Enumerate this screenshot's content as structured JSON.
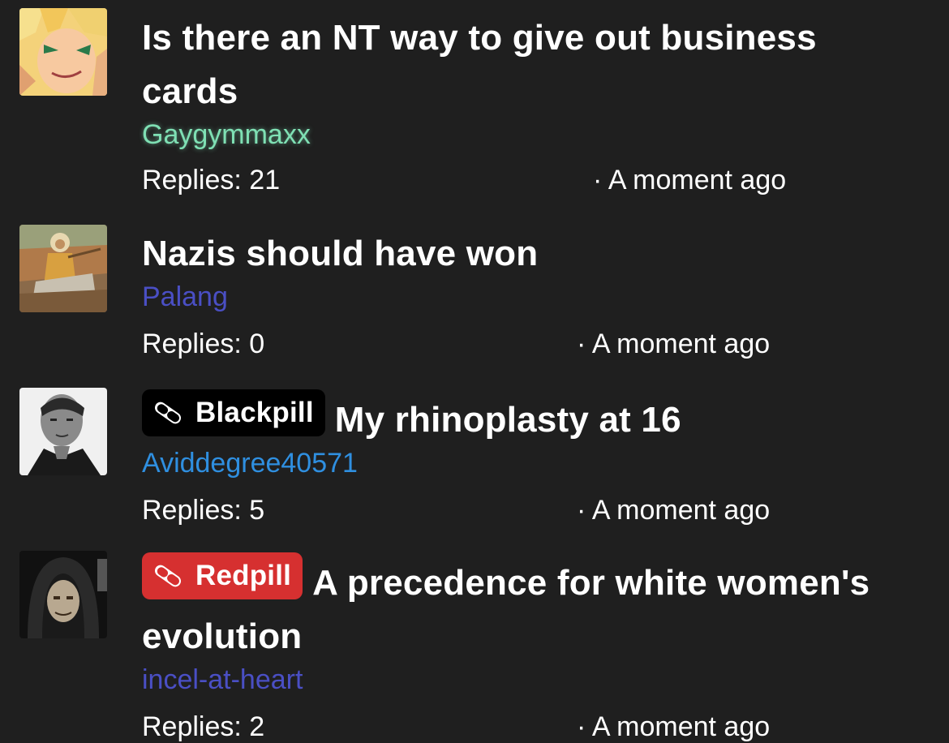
{
  "threads": [
    {
      "title": "Is there an NT way to give out business cards",
      "author": "Gaygymmaxx",
      "author_color": "#7fe0b4",
      "author_glow": true,
      "replies": "Replies: 21",
      "time": "· A moment ago",
      "tag": null,
      "avatar_icon": "anime-character-avatar"
    },
    {
      "title": "Nazis should have won",
      "author": "Palang",
      "author_color": "#4a4fc4",
      "replies": "Replies: 0",
      "time": "· A moment ago",
      "tag": null,
      "avatar_icon": "painting-horseman-avatar"
    },
    {
      "title": "My rhinoplasty at 16",
      "author": "Aviddegree40571",
      "author_color": "#2f8fe0",
      "replies": "Replies: 5",
      "time": "· A moment ago",
      "tag": {
        "label": "Blackpill",
        "color": "#000000",
        "icon": "pill-icon"
      },
      "avatar_icon": "bw-portrait-avatar"
    },
    {
      "title": "A precedence for white women's evolution",
      "author": "incel-at-heart",
      "author_color": "#4a4fc4",
      "replies": "Replies: 2",
      "time": "· A moment ago",
      "tag": {
        "label": "Redpill",
        "color": "#d63030",
        "icon": "pill-icon"
      },
      "avatar_icon": "hooded-figure-avatar"
    }
  ]
}
